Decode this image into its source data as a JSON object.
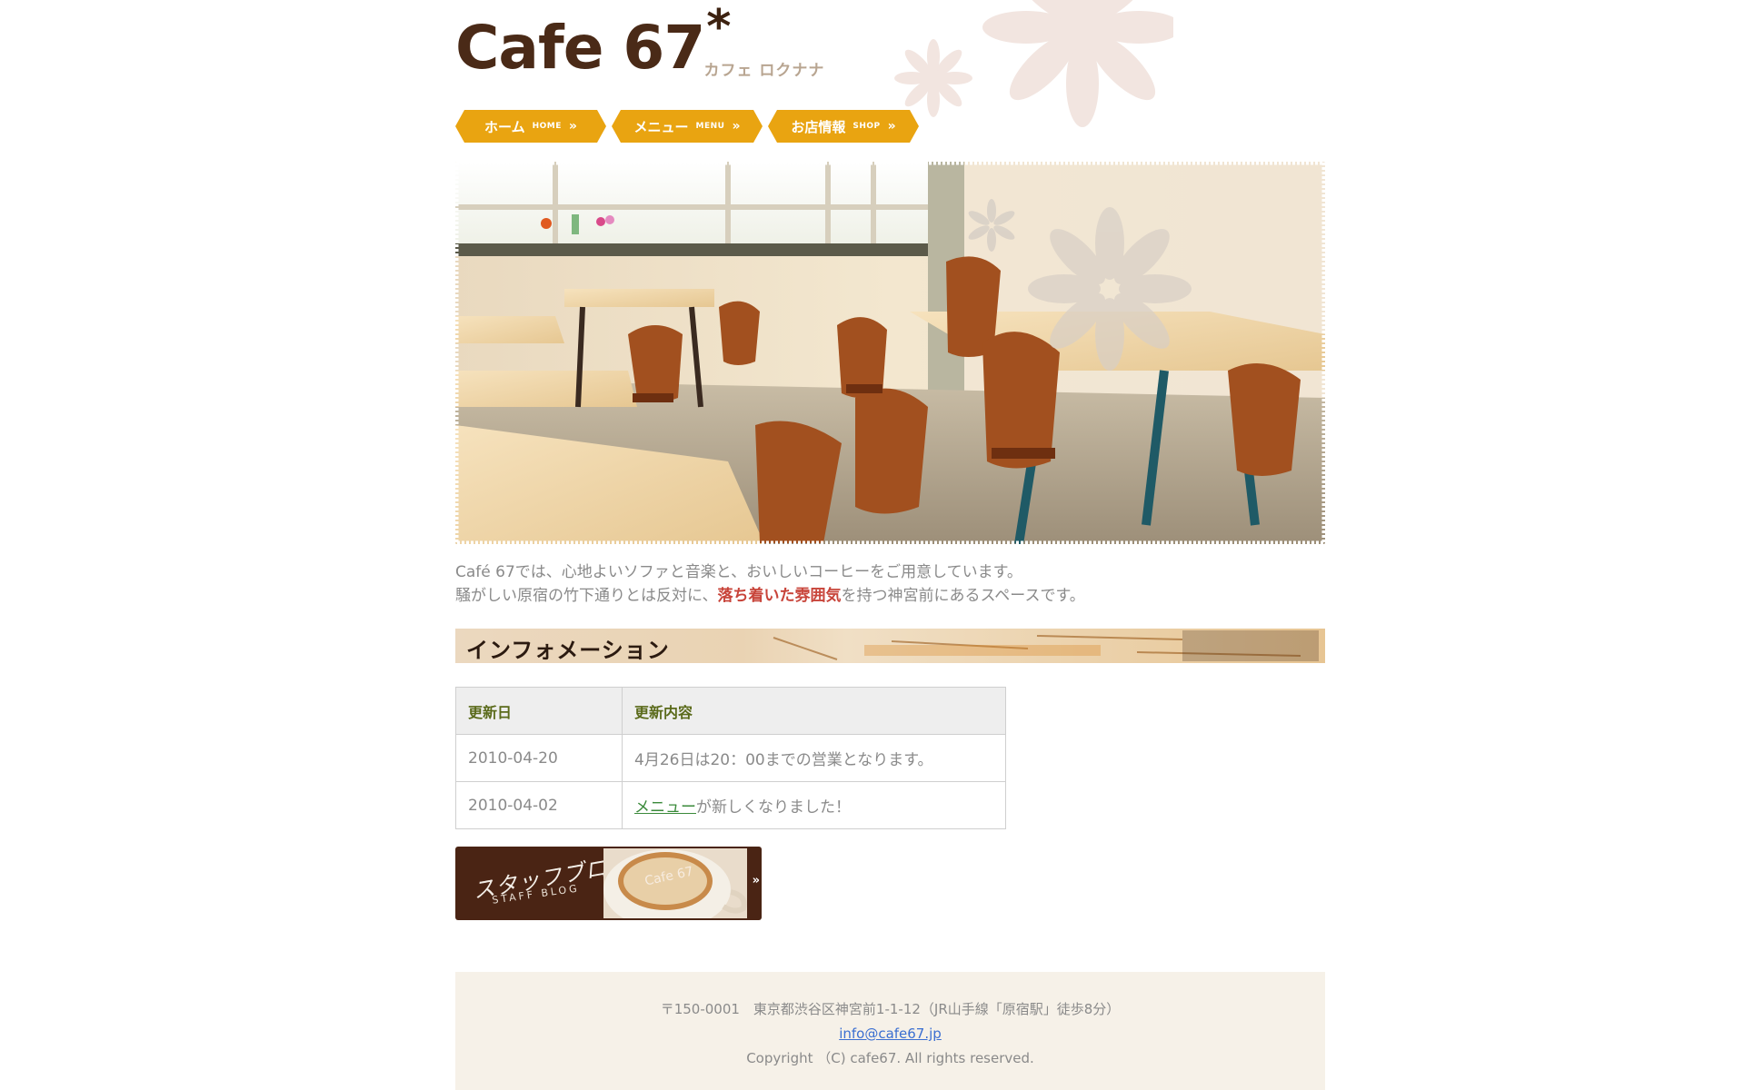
{
  "header": {
    "logo_text": "Cafe 67",
    "logo_asterisk": "*",
    "logo_sub": "カフェ ロクナナ"
  },
  "nav": {
    "items": [
      {
        "label_jp": "ホーム",
        "label_en": "HOME",
        "arrow": "»"
      },
      {
        "label_jp": "メニュー",
        "label_en": "MENU",
        "arrow": "»"
      },
      {
        "label_jp": "お店情報",
        "label_en": "SHOP",
        "arrow": "»"
      }
    ]
  },
  "intro": {
    "line1": "Café 67では、心地よいソファと音楽と、おいしいコーヒーをご用意しています。",
    "line2_before": "騒がしい原宿の竹下通りとは反対に、",
    "line2_accent": "落ち着いた雰囲気",
    "line2_after": "を持つ神宮前にあるスペースです。"
  },
  "info": {
    "title": "インフォメーション",
    "headers": [
      "更新日",
      "更新内容"
    ],
    "rows": [
      {
        "date": "2010-04-20",
        "content": "4月26日は20：00までの営業となります。"
      },
      {
        "date": "2010-04-02",
        "link_text": "メニュー",
        "content_after": "が新しくなりました！"
      }
    ]
  },
  "blog": {
    "title_jp": "スタッフブログ",
    "title_en": "STAFF BLOG",
    "latte_text": "Cafe 67",
    "arrow": "»"
  },
  "footer": {
    "address": "〒150-0001　東京都渋谷区神宮前1-1-12（JR山手線「原宿駅」徒歩8分）",
    "email": "info@cafe67.jp",
    "copyright": "Copyright （C) cafe67. All rights reserved."
  },
  "colors": {
    "brand_brown": "#4a2a17",
    "nav_orange": "#e9a411",
    "accent_red": "#c8443a",
    "link_green": "#3a8a3a",
    "footer_bg": "#f6f1e8"
  }
}
